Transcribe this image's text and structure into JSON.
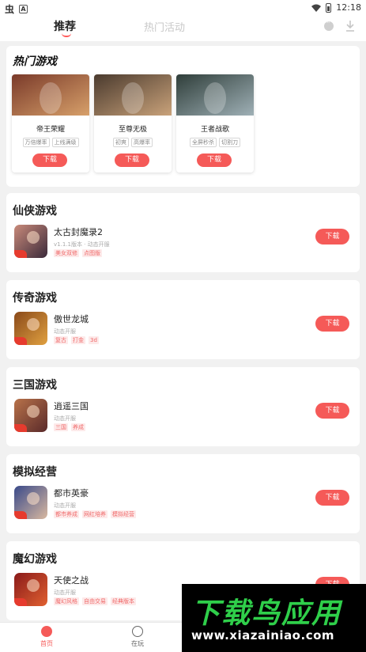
{
  "status_bar": {
    "time": "12:18",
    "glyph": "虫",
    "app_badge": "A"
  },
  "top_tabs": {
    "recommend": "推荐",
    "activities": "热门活动"
  },
  "hot": {
    "title": "热门游戏",
    "items": [
      {
        "name": "帝王荣耀",
        "tags": [
          "万倍爆率",
          "上线满级"
        ],
        "button": "下载",
        "colors": [
          "#7a3a2a",
          "#d7a06a"
        ]
      },
      {
        "name": "至尊无极",
        "tags": [
          "初爽",
          "高爆率"
        ],
        "button": "下载",
        "colors": [
          "#4a3a2e",
          "#c9a27a"
        ]
      },
      {
        "name": "王者战歌",
        "tags": [
          "全屏秒杀",
          "切割刀"
        ],
        "button": "下载",
        "colors": [
          "#2f3e3a",
          "#9fb0b6"
        ]
      }
    ]
  },
  "categories": [
    {
      "title": "仙侠游戏",
      "game": "太古封魔录2",
      "sub": "v1.1.1版本 · 动态开服",
      "tags": [
        "美女双修",
        "点图版"
      ],
      "button": "下载",
      "colors": [
        "#c98a7a",
        "#3b2a3a"
      ]
    },
    {
      "title": "传奇游戏",
      "game": "傲世龙城",
      "sub": "动态开服",
      "tags": [
        "复古",
        "打金",
        "3d"
      ],
      "button": "下载",
      "colors": [
        "#8a4a1a",
        "#e0a040"
      ]
    },
    {
      "title": "三国游戏",
      "game": "逍遥三国",
      "sub": "动态开服",
      "tags": [
        "三国",
        "养成"
      ],
      "button": "下载",
      "colors": [
        "#b8724a",
        "#5a2a2a"
      ]
    },
    {
      "title": "模拟经营",
      "game": "都市英豪",
      "sub": "动态开服",
      "tags": [
        "都市养成",
        "网红培养",
        "模拟经营"
      ],
      "button": "下载",
      "colors": [
        "#3a4a8a",
        "#d8b8a0"
      ]
    },
    {
      "title": "魔幻游戏",
      "game": "天使之战",
      "sub": "动态开服",
      "tags": [
        "魔幻风格",
        "自由交易",
        "经典版本"
      ],
      "button": "下载",
      "colors": [
        "#8a1a1a",
        "#e06030"
      ]
    }
  ],
  "bottom_nav": {
    "home": "首页",
    "playing": "在玩",
    "accent": "#f55a58"
  },
  "watermark": {
    "title": "下载鸟应用",
    "url": "www.xiazainiao.com"
  }
}
